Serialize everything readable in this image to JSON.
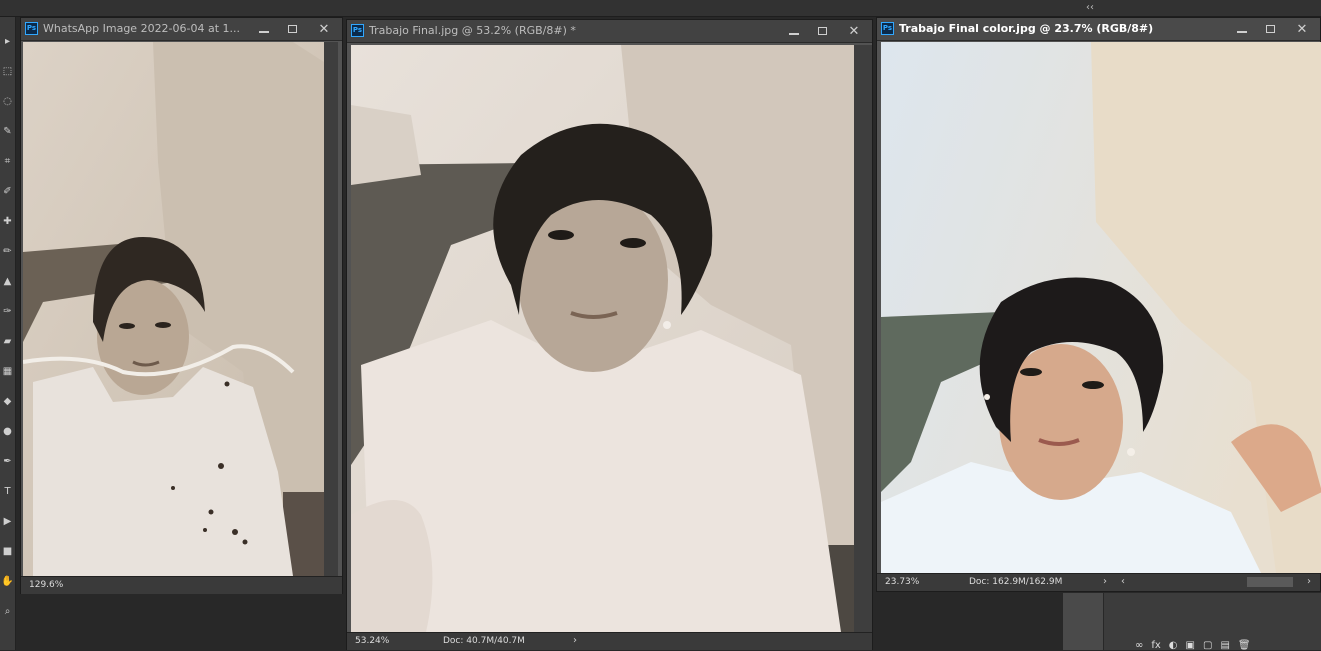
{
  "topbar": {
    "collapse_glyph": "‹‹"
  },
  "toolbar": {
    "tools": [
      {
        "name": "move-tool-icon",
        "glyph": "▸"
      },
      {
        "name": "marquee-tool-icon",
        "glyph": "⬚"
      },
      {
        "name": "lasso-tool-icon",
        "glyph": "◌"
      },
      {
        "name": "quick-select-tool-icon",
        "glyph": "✎"
      },
      {
        "name": "crop-tool-icon",
        "glyph": "⌗"
      },
      {
        "name": "eyedropper-tool-icon",
        "glyph": "✐"
      },
      {
        "name": "healing-brush-tool-icon",
        "glyph": "✚"
      },
      {
        "name": "brush-tool-icon",
        "glyph": "✏"
      },
      {
        "name": "clone-stamp-tool-icon",
        "glyph": "▲"
      },
      {
        "name": "history-brush-tool-icon",
        "glyph": "✑"
      },
      {
        "name": "eraser-tool-icon",
        "glyph": "▰"
      },
      {
        "name": "gradient-tool-icon",
        "glyph": "▦"
      },
      {
        "name": "blur-tool-icon",
        "glyph": "◆"
      },
      {
        "name": "dodge-tool-icon",
        "glyph": "●"
      },
      {
        "name": "pen-tool-icon",
        "glyph": "✒"
      },
      {
        "name": "type-tool-icon",
        "glyph": "T"
      },
      {
        "name": "path-select-tool-icon",
        "glyph": "▶"
      },
      {
        "name": "shape-tool-icon",
        "glyph": "■"
      },
      {
        "name": "hand-tool-icon",
        "glyph": "✋"
      },
      {
        "name": "zoom-tool-icon",
        "glyph": "⌕"
      }
    ]
  },
  "windows": [
    {
      "title": "WhatsApp Image 2022-06-04 at 1...",
      "zoom": "129.6%",
      "doc": ""
    },
    {
      "title": "Trabajo Final.jpg @ 53.2% (RGB/8#) *",
      "zoom": "53.24%",
      "doc": "Doc: 40.7M/40.7M",
      "arrow": "›"
    },
    {
      "title": "Trabajo Final color.jpg @ 23.7% (RGB/8#)",
      "zoom": "23.73%",
      "doc": "Doc: 162.9M/162.9M",
      "arrow": "›",
      "scroll_left": "‹",
      "scroll_right": "›"
    }
  ],
  "window_controls": {
    "minimize": "minimize-icon",
    "restore": "restore-icon",
    "close": "✕"
  },
  "panel_icons": [
    "∞",
    "fx",
    "◐",
    "▣",
    "▢",
    "▤",
    "🗑"
  ],
  "colors": {
    "workspace": "#282828",
    "doc_background": "#535353",
    "accent": "#31a8ff"
  }
}
